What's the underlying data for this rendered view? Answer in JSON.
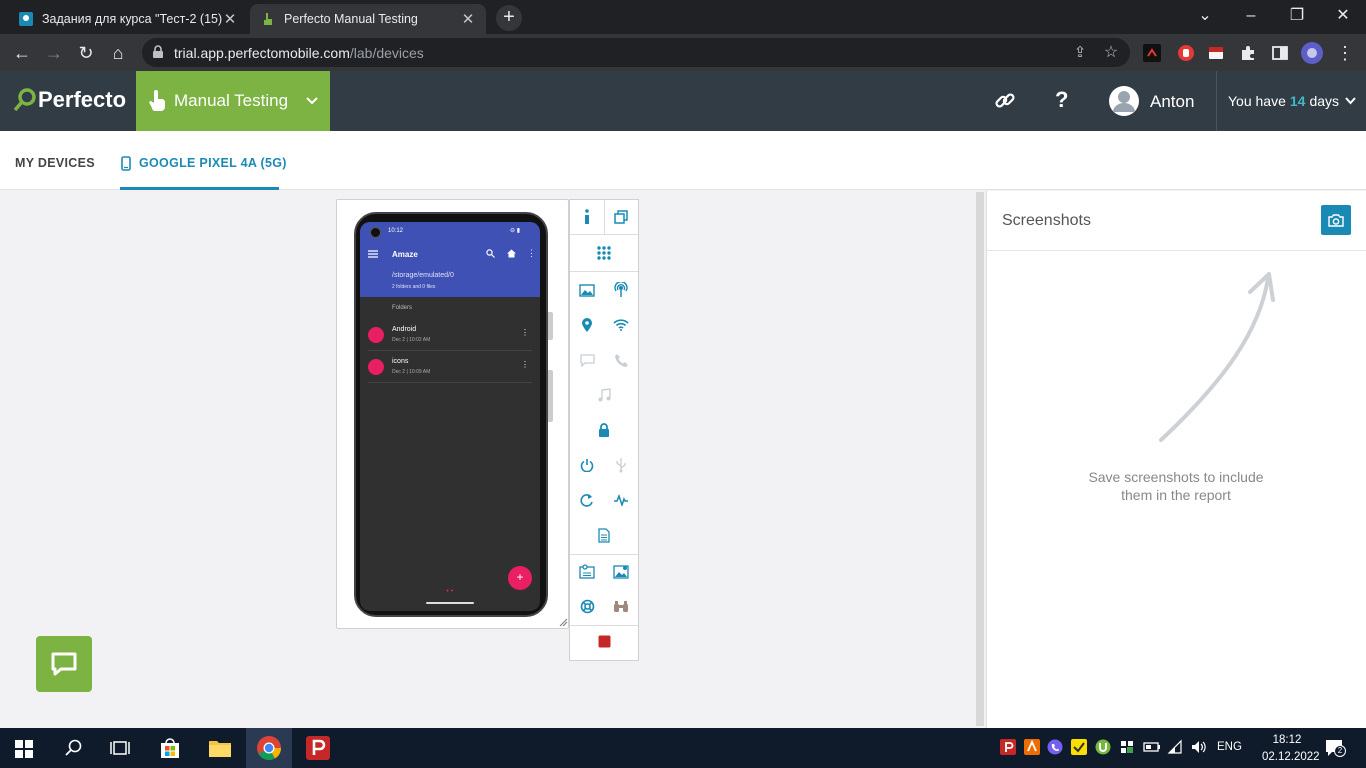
{
  "browser": {
    "tabs": [
      {
        "title": "Задания для курса \"Тест-2 (15)\"",
        "close": "✕"
      },
      {
        "title": "Perfecto Manual Testing",
        "close": "✕"
      }
    ],
    "new_tab": "+",
    "url_host": "trial.app.perfectomobile.com",
    "url_path": "/lab/devices"
  },
  "header": {
    "brand": "Perfecto",
    "mode": "Manual Testing",
    "user": "Anton",
    "trial_prefix": "You have",
    "trial_days": "14",
    "trial_suffix": "days"
  },
  "tabs": {
    "my_devices": "MY DEVICES",
    "device": "GOOGLE PIXEL 4A (5G)"
  },
  "phone": {
    "time": "10:12",
    "app_title": "Amaze",
    "path": "/storage/emulated/0",
    "summary": "2 folders and 0 files",
    "section": "Folders",
    "folders": [
      {
        "name": "Android",
        "date": "Dec 2 | 10:02 AM"
      },
      {
        "name": "icons",
        "date": "Dec 2 | 10:09 AM"
      }
    ],
    "fab": "+"
  },
  "screenshots": {
    "title": "Screenshots",
    "empty_line1": "Save screenshots to include",
    "empty_line2": "them in the report"
  },
  "taskbar": {
    "lang": "ENG",
    "time": "18:12",
    "date": "02.12.2022",
    "notif_count": "2"
  },
  "colors": {
    "accent_green": "#7cb342",
    "accent_blue": "#1a8ab5",
    "header_bg": "#323c45"
  }
}
